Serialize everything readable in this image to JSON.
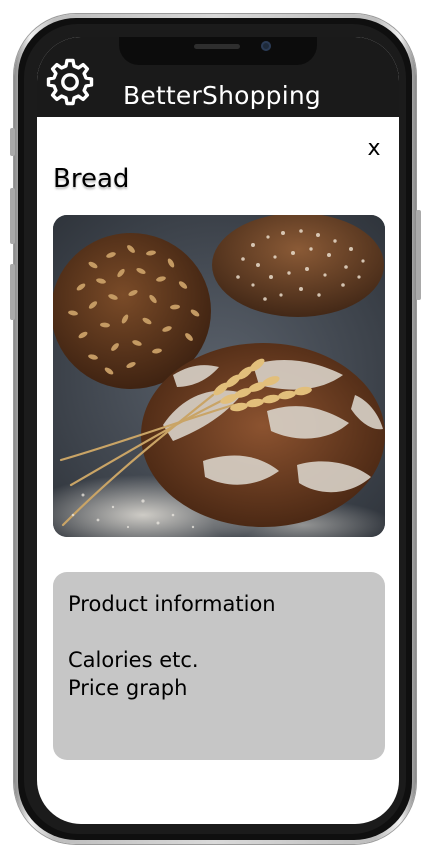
{
  "app": {
    "title": "BetterShopping",
    "settings_icon": "gear-icon"
  },
  "product": {
    "title": "Bread",
    "close_label": "x",
    "image_alt": "Bread"
  },
  "info_card": {
    "heading": "Product information",
    "line1": "Calories etc.",
    "line2": "Price graph"
  },
  "colors": {
    "header_bg": "#1a1a1a",
    "card_bg": "#c6c6c6",
    "screen_bg": "#ffffff"
  }
}
